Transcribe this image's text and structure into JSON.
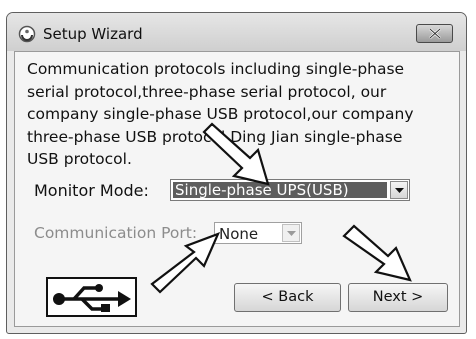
{
  "window": {
    "title": "Setup Wizard",
    "close_label": "×"
  },
  "description": "Communication protocols including single-phase serial protocol,three-phase serial protocol, our company single-phase USB protocol,our company three-phase USB protocol,Ding Jian single-phase USB protocol.",
  "monitor_mode": {
    "label": "Monitor Mode:",
    "selected": "Single-phase UPS(USB)"
  },
  "communication_port": {
    "label": "Communication Port:",
    "selected": "None",
    "enabled": false
  },
  "buttons": {
    "back": "< Back",
    "next": "Next >"
  },
  "icons": [
    "setup-wizard-app-icon",
    "close-icon",
    "chevron-down-icon",
    "usb-logo-icon",
    "annotation-arrow-icon"
  ],
  "colors": {
    "selection_highlight": "#5e5e5e",
    "disabled_text": "#8c8c8c",
    "client_background": "#f5f5f5"
  }
}
